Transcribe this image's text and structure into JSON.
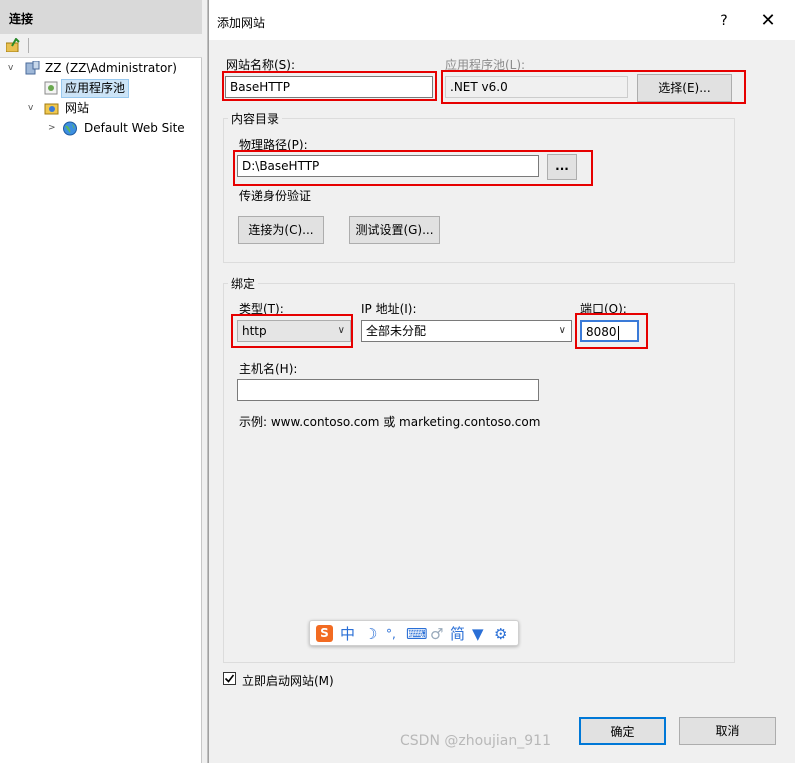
{
  "left_pane": {
    "header": "连接",
    "tree": {
      "server": "ZZ (ZZ\\Administrator)",
      "app_pools": "应用程序池",
      "sites": "网站",
      "default_site": "Default Web Site"
    }
  },
  "dialog": {
    "title": "添加网站",
    "help_glyph": "?",
    "close_glyph": "✕",
    "site_name": {
      "label": "网站名称(S):",
      "value": "BaseHTTP"
    },
    "app_pool": {
      "label": "应用程序池(L):",
      "value": ".NET v6.0",
      "select_button": "选择(E)..."
    },
    "content_directory": {
      "group_label": "内容目录",
      "physical_path_label": "物理路径(P):",
      "physical_path_value": "D:\\BaseHTTP",
      "browse_button": "...",
      "pass_through_auth_label": "传递身份验证",
      "connect_as_button": "连接为(C)...",
      "test_settings_button": "测试设置(G)..."
    },
    "binding": {
      "group_label": "绑定",
      "type_label": "类型(T):",
      "type_value": "http",
      "ip_label": "IP 地址(I):",
      "ip_value": "全部未分配",
      "port_label": "端口(O):",
      "port_value": "8080",
      "hostname_label": "主机名(H):",
      "hostname_value": "",
      "example_text": "示例: www.contoso.com 或 marketing.contoso.com"
    },
    "ime_toolbar": {
      "logo": "🅂",
      "lang": "中",
      "simplified": "简"
    },
    "start_immediately": {
      "label": "立即启动网站(M)",
      "checked": true
    },
    "ok_button": "确定",
    "cancel_button": "取消"
  },
  "watermark": "CSDN @zhoujian_911",
  "colors": {
    "highlight_red": "#e60000",
    "selection_blue": "#cce4f7",
    "dialog_bg": "#f0f0f0"
  }
}
